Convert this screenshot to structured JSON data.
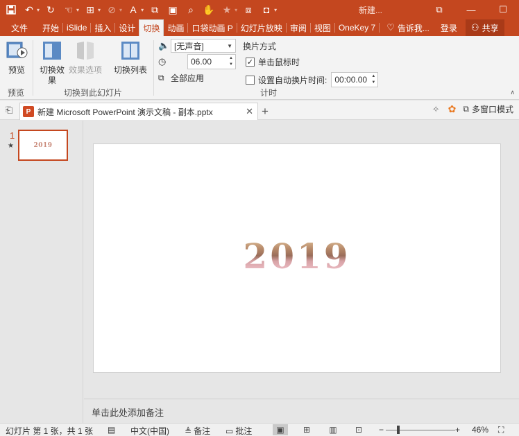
{
  "titlebar": {
    "title": "新建...",
    "icons": [
      "save-icon",
      "undo-icon",
      "redo-icon",
      "touch-mode-icon",
      "new-slide-icon",
      "disabled-icon",
      "font-color-icon",
      "screenshot-icon",
      "presenter-icon",
      "search-icon",
      "touch-icon",
      "star-icon",
      "layout-icon",
      "video-icon"
    ],
    "window_buttons": {
      "restore": "⧉",
      "minimize": "—",
      "maximize": "☐",
      "close": "✕"
    }
  },
  "tabs": {
    "file": "文件",
    "items": [
      "开始",
      "iSlide",
      "插入",
      "设计",
      "切换",
      "动画",
      "口袋动画 P",
      "幻灯片放映",
      "审阅",
      "视图",
      "OneKey 7"
    ],
    "active": "切换",
    "tell_me": "告诉我...",
    "login": "登录",
    "share": "共享"
  },
  "ribbon": {
    "preview_group": {
      "button": "预览",
      "label": "预览"
    },
    "transition_group": {
      "effect_btn": "切换效果",
      "options_btn": "效果选项",
      "list_btn": "切换列表",
      "label": "切换到此幻灯片"
    },
    "timing_group": {
      "sound": "[无声音]",
      "duration": "06.00",
      "apply_all": "全部应用",
      "advance_title": "换片方式",
      "on_click": "单击鼠标时",
      "after_label": "设置自动换片时间:",
      "after_value": "00:00.00",
      "label": "计时"
    }
  },
  "doctab": {
    "filename": "新建 Microsoft PowerPoint 演示文稿 - 副本.pptx",
    "badge": "P",
    "multiwindow": "多窗口模式"
  },
  "thumbnails": [
    {
      "number": "1",
      "star": "★",
      "text": "2019"
    }
  ],
  "slide": {
    "title": "2019"
  },
  "notes": {
    "placeholder": "单击此处添加备注"
  },
  "statusbar": {
    "slide_info": "幻灯片 第 1 张，共 1 张",
    "language": "中文(中国)",
    "notes": "备注",
    "comments": "批注",
    "zoom": "46%",
    "zoom_minus": "−",
    "zoom_plus": "+"
  },
  "colors": {
    "accent": "#c4471f",
    "ribbon_bg": "#f3f3f3",
    "workspace_bg": "#e6e6e6"
  }
}
